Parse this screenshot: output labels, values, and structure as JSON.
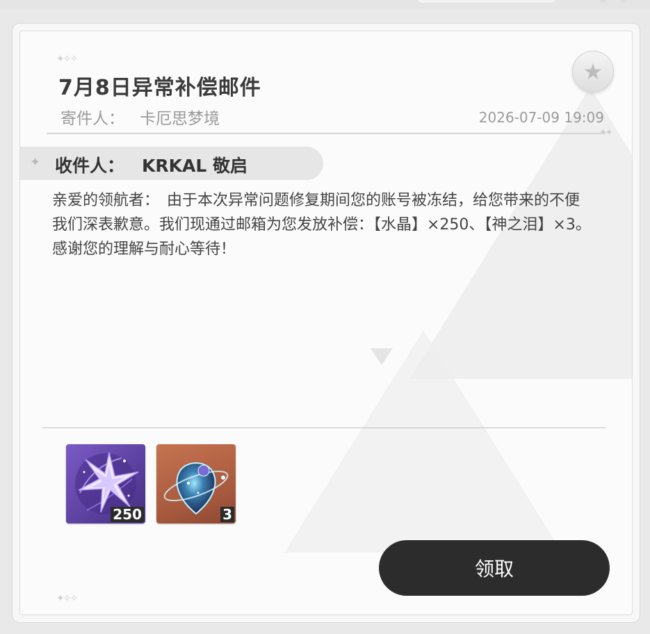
{
  "mail": {
    "title": "7月8日异常补偿邮件",
    "sender_label": "寄件人：",
    "sender_name": "卡厄思梦境",
    "datetime": "2026-07-09 19:09",
    "recipient_label": "收件人：",
    "recipient_name": "KRKAL 敬启",
    "body": "亲爱的领航者：　由于本次异常问题修复期间您的账号被冻结，给您带来的不便我们深表歉意。我们现通过邮箱为您发放补偿：【水晶】×250、【神之泪】×3。 感谢您的理解与耐心等待！"
  },
  "attachments": [
    {
      "icon": "crystal-icon",
      "quantity": "250",
      "color": "#6b4fb5"
    },
    {
      "icon": "tear-of-god-icon",
      "quantity": "3",
      "color": "#b8643f"
    }
  ],
  "actions": {
    "claim_label": "领取",
    "star_icon": "star-icon"
  }
}
